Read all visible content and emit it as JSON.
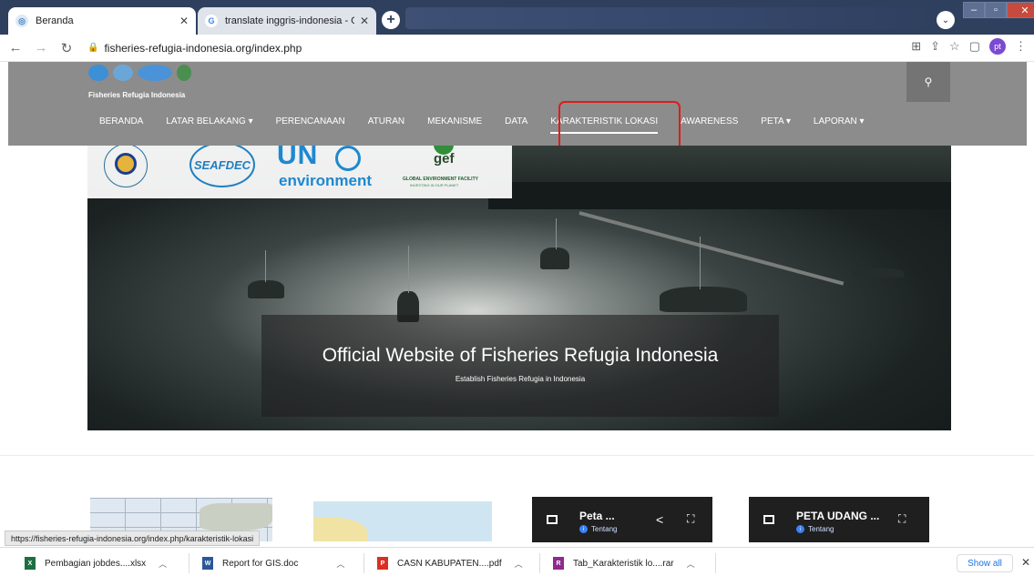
{
  "browser": {
    "tabs": [
      {
        "title": "Beranda",
        "active": true,
        "favicon": "web-icon"
      },
      {
        "title": "translate inggris-indonesia - Goo",
        "active": false,
        "favicon": "google-icon"
      }
    ],
    "new_tab": "+",
    "url": "fisheries-refugia-indonesia.org/index.php",
    "profile_initials": "pt",
    "status_url": "https://fisheries-refugia-indonesia.org/index.php/karakteristik-lokasi"
  },
  "site": {
    "brand": "Fisheries Refugia Indonesia",
    "menu": [
      {
        "label": "BERANDA"
      },
      {
        "label": "LATAR BELAKANG ▾"
      },
      {
        "label": "PERENCANAAN"
      },
      {
        "label": "ATURAN"
      },
      {
        "label": "MEKANISME"
      },
      {
        "label": "DATA"
      },
      {
        "label": "KARAKTERISTIK LOKASI"
      },
      {
        "label": "AWARENESS"
      },
      {
        "label": "PETA ▾"
      },
      {
        "label": "LAPORAN ▾"
      }
    ],
    "partners": {
      "seafdec": "SEAFDEC",
      "un": "UN",
      "environment": "environment",
      "gef": "gef",
      "gef_name": "GLOBAL ENVIRONMENT FACILITY",
      "gef_tagline": "INVESTING IN OUR PLANET"
    },
    "hero": {
      "title": "Official Website of Fisheries Refugia Indonesia",
      "subtitle": "Establish Fisheries Refugia in Indonesia"
    },
    "cards": [
      {
        "title": "Peta ...",
        "info": "Tentang"
      },
      {
        "title": "PETA UDANG ...",
        "info": "Tentang"
      }
    ]
  },
  "downloads": {
    "items": [
      {
        "name": "Pembagian jobdes....xlsx",
        "type": "xlsx",
        "color": "#1d6f42"
      },
      {
        "name": "Report for GIS.doc",
        "type": "doc",
        "color": "#2b579a"
      },
      {
        "name": "CASN KABUPATEN....pdf",
        "type": "pdf",
        "color": "#d93025"
      },
      {
        "name": "Tab_Karakteristik lo....rar",
        "type": "rar",
        "color": "#8e2a8e"
      }
    ],
    "show_all": "Show all"
  },
  "colors": {
    "highlight": "#e11b1b",
    "header_bg": "#8c8c8c",
    "tabbar_bg": "#2f3f5e"
  }
}
